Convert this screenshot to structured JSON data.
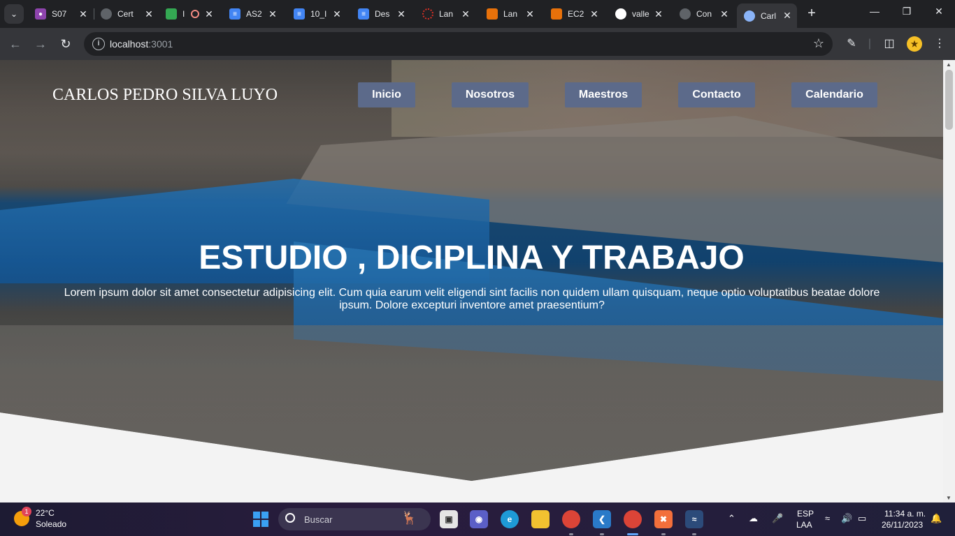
{
  "browser": {
    "tabs": [
      {
        "title": "S07",
        "favicon_color": "#8e44ad",
        "favicon": "person-icon"
      },
      {
        "title": "Cert",
        "favicon_color": "#5f6368",
        "favicon": "globe-icon"
      },
      {
        "title": "I",
        "favicon_color": "#34a853",
        "favicon": "meet-icon"
      },
      {
        "title": "AS2",
        "favicon_color": "#4285f4",
        "favicon": "docs-icon"
      },
      {
        "title": "10_I",
        "favicon_color": "#4285f4",
        "favicon": "docs-icon"
      },
      {
        "title": "Des",
        "favicon_color": "#4285f4",
        "favicon": "docs-icon"
      },
      {
        "title": "Lan",
        "favicon_color": "#d93025",
        "favicon": "loading-icon"
      },
      {
        "title": "Lan",
        "favicon_color": "#e8710a",
        "favicon": "aws-icon"
      },
      {
        "title": "EC2",
        "favicon_color": "#e8710a",
        "favicon": "aws-icon"
      },
      {
        "title": "valle",
        "favicon_color": "#ffffff",
        "favicon": "github-icon"
      },
      {
        "title": "Con",
        "favicon_color": "#5f6368",
        "favicon": "globe-icon"
      },
      {
        "title": "Carl",
        "favicon_color": "#8ab4f8",
        "favicon": "globe-icon"
      }
    ],
    "url_host": "localhost",
    "url_port": ":3001"
  },
  "page": {
    "brand": "CARLOS PEDRO SILVA LUYO",
    "nav": [
      "Inicio",
      "Nosotros",
      "Maestros",
      "Contacto",
      "Calendario"
    ],
    "hero_title": "ESTUDIO , DICIPLINA Y TRABAJO",
    "hero_text": "Lorem ipsum dolor sit amet consectetur adipisicing elit. Cum quia earum velit eligendi sint facilis non quidem ullam quisquam, neque optio voluptatibus beatae dolore ipsum. Dolore excepturi inventore amet praesentium?",
    "accent_nav_color": "#5c6a8a"
  },
  "taskbar": {
    "weather_badge": "1",
    "temperature": "22°C",
    "condition": "Soleado",
    "search_label": "Buscar",
    "lang_line1": "ESP",
    "lang_line2": "LAA",
    "time": "11:34 a. m.",
    "date": "26/11/2023"
  }
}
